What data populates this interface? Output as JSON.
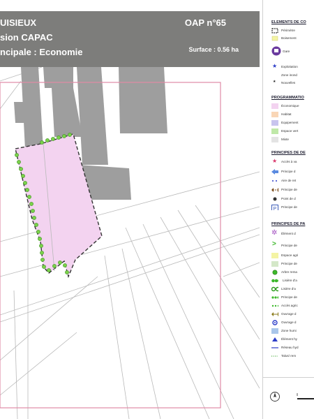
{
  "header": {
    "line1": "UISIEUX",
    "line2": "sion CAPAC",
    "line3": "ncipale : Economie",
    "oap": "OAP n°65",
    "surface": "Surface : 0.56 ha"
  },
  "legend": {
    "sec1": "ELEMENTS DE CO",
    "sec1_items": [
      {
        "label": "Périmètre",
        "icon": "dashed-rect-icon"
      },
      {
        "label": "Boisement",
        "icon": "yellow-rect-icon"
      },
      {
        "label": "Gare",
        "icon": "train-station-icon"
      },
      {
        "label": "Exploitation",
        "icon": "star-icon"
      },
      {
        "label": "Zone inond",
        "icon": "blank-icon"
      },
      {
        "label": "Nouvelles",
        "icon": "small-star-icon"
      }
    ],
    "sec2": "PROGRAMMATIO",
    "sec2_items": [
      {
        "label": "Économique",
        "color": "#f3d3f0"
      },
      {
        "label": "Habitat",
        "color": "#f9d6b6"
      },
      {
        "label": "Equipement",
        "color": "#c8c4ee"
      },
      {
        "label": "Espace vert",
        "color": "#bfe8a8"
      },
      {
        "label": "Mixte",
        "color": "#e3e3e3"
      }
    ],
    "sec3": "PRINCIPES DE DE",
    "sec3_items": [
      {
        "label": "Accès à va",
        "icon": "pink-star-icon"
      },
      {
        "label": "Principe d",
        "icon": "blue-arrow-icon"
      },
      {
        "label": "Aire de ret",
        "icon": "dashed-blue-icon"
      },
      {
        "label": "Principe de",
        "icon": "double-arrow-icon"
      },
      {
        "label": "Point de d",
        "icon": "pin-icon"
      },
      {
        "label": "Principe de",
        "icon": "parking-icon"
      }
    ],
    "sec4": "PRINCIPES DE PA",
    "sec4_items": [
      {
        "label": "Élément d",
        "icon": "flower-icon"
      },
      {
        "label": "Principe de",
        "icon": "green-chevron-icon"
      },
      {
        "label": "Espace agri",
        "icon": "yellow-rect-icon"
      },
      {
        "label": "Principe de",
        "icon": "green-rect-icon"
      },
      {
        "label": "Arbre rema",
        "icon": "tree-icon"
      },
      {
        "label": "Lisière d'a",
        "icon": "hedge-icon"
      },
      {
        "label": "Lisière d'a",
        "icon": "double-circle-icon"
      },
      {
        "label": "Principe de",
        "icon": "dots-icon"
      },
      {
        "label": "Accès agric",
        "icon": "dots-small-icon"
      },
      {
        "label": "Ouvrage d",
        "icon": "yellow-double-arrow-icon"
      },
      {
        "label": "Ouvrage d",
        "icon": "blue-circle-icon"
      },
      {
        "label": "Zone humi",
        "icon": "blue-rect-icon"
      },
      {
        "label": "Élément hy",
        "icon": "blue-triangle-icon"
      },
      {
        "label": "Réseau hyd",
        "icon": "blue-line-icon"
      },
      {
        "label": "Talus/ rem",
        "icon": "dotted-line-icon"
      }
    ]
  },
  "colors": {
    "header_bg": "#7d7d7b",
    "zone_fill": "#f3d3f0",
    "building": "#9e9e9e",
    "hedge": "#7ad24a",
    "perimeter_pink": "#e08aa6"
  }
}
